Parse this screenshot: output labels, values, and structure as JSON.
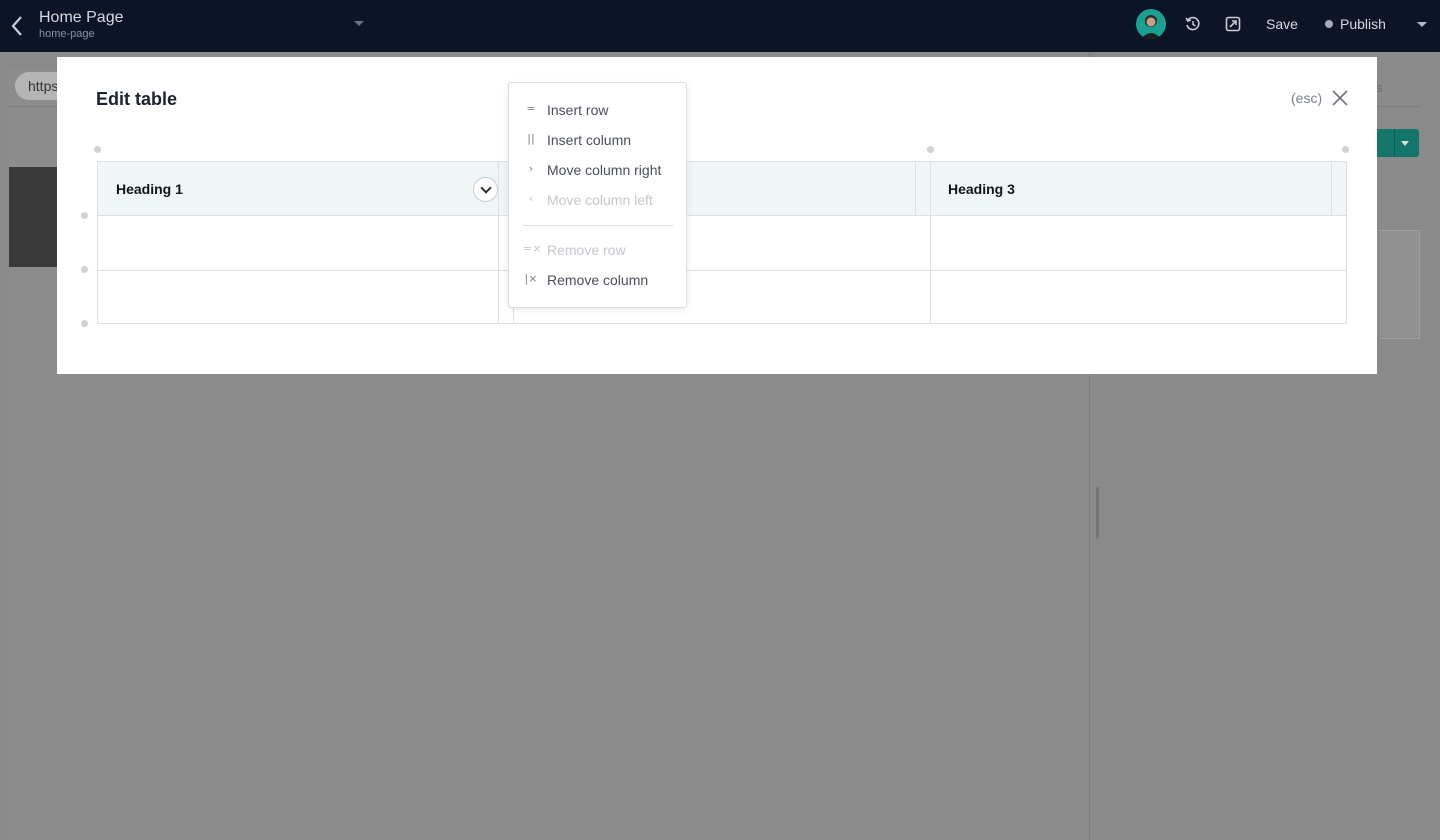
{
  "topbar": {
    "page_title": "Home Page",
    "page_slug": "home-page",
    "save_label": "Save",
    "publish_label": "Publish"
  },
  "editor": {
    "url_fragment": "https"
  },
  "modal": {
    "title": "Edit table",
    "esc_hint": "(esc)",
    "table": {
      "headings": [
        "Heading 1",
        "",
        "Heading 3"
      ],
      "rows": [
        [
          "",
          "",
          ""
        ],
        [
          "",
          "",
          ""
        ]
      ]
    }
  },
  "context_menu": {
    "items": [
      {
        "label": "Insert row",
        "icon": "insert-row-icon",
        "glyph": "=",
        "disabled": false
      },
      {
        "label": "Insert column",
        "icon": "insert-column-icon",
        "glyph": "||",
        "disabled": false
      },
      {
        "label": "Move column right",
        "icon": "chevron-right-icon",
        "glyph": "›",
        "disabled": false
      },
      {
        "label": "Move column left",
        "icon": "chevron-left-icon",
        "glyph": "‹",
        "disabled": true
      },
      {
        "label": "Remove row",
        "icon": "remove-row-icon",
        "glyph": "=×",
        "disabled": true
      },
      {
        "label": "Remove column",
        "icon": "remove-column-icon",
        "glyph": "|×",
        "disabled": false
      }
    ]
  },
  "colors": {
    "topbar_bg": "#0e1428",
    "overlay": "#8a8a8a",
    "table_header_bg": "#f0f6f6",
    "accent_teal": "#14756b"
  }
}
